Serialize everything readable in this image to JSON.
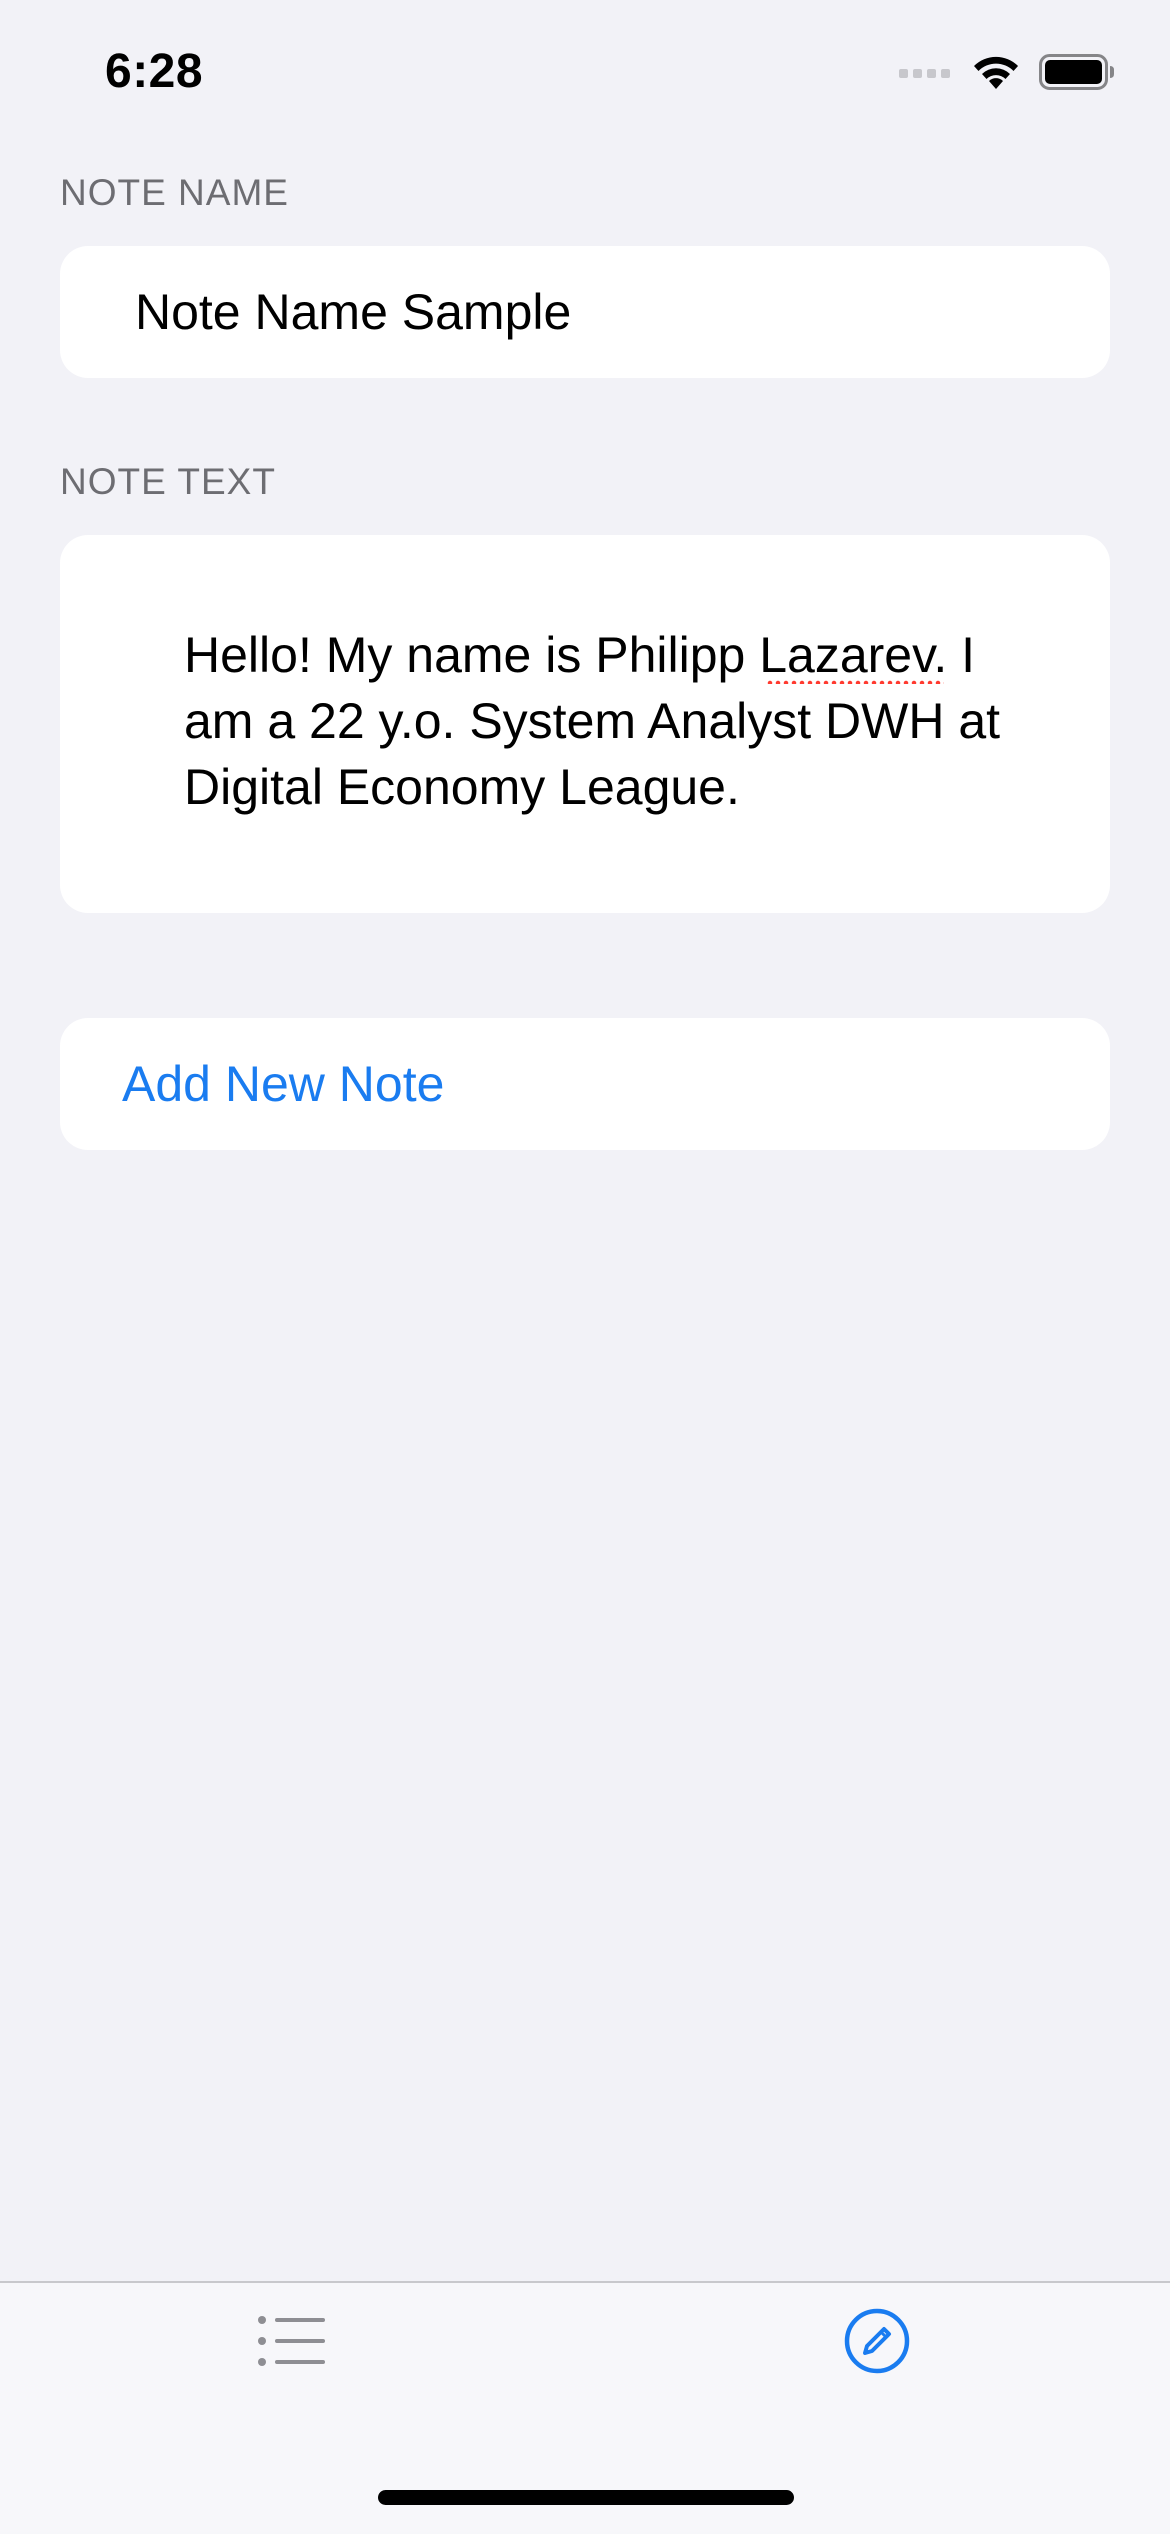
{
  "status_bar": {
    "time": "6:28",
    "icons": [
      "signal-icon",
      "wifi-icon",
      "battery-icon"
    ]
  },
  "form": {
    "note_name": {
      "label": "NOTE NAME",
      "value": "Note Name Sample"
    },
    "note_text": {
      "label": "NOTE TEXT",
      "value": "Hello! My name is Philipp Lazarev. I am a 22 y.o. System Analyst DWH at Digital Economy League."
    },
    "add_button_label": "Add New Note"
  },
  "tab_bar": {
    "items": [
      {
        "icon": "list-icon",
        "selected": false
      },
      {
        "icon": "compose-icon",
        "selected": true
      }
    ]
  },
  "colors": {
    "accent": "#1a7cf0",
    "background": "#f2f2f7",
    "card": "#ffffff",
    "label_gray": "#6d6d72",
    "tab_inactive": "#8e8e93",
    "spellcheck": "#ff3b30"
  }
}
